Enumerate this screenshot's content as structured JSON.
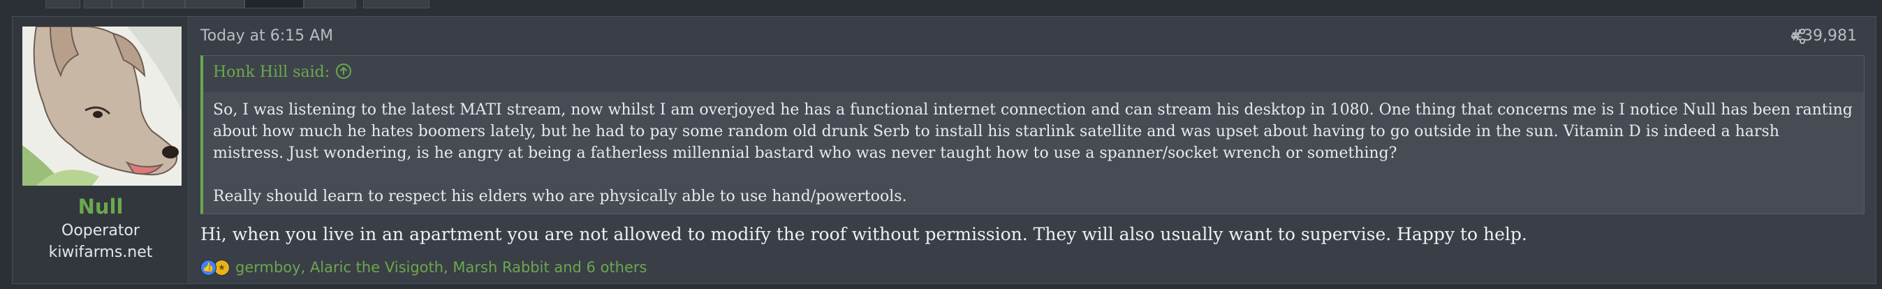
{
  "post": {
    "username": "Null",
    "user_title": "Ooperator",
    "user_extra": "kiwifarms.net",
    "date": "Today at 6:15 AM",
    "post_number": "#39,981",
    "quote": {
      "author_line": "Honk Hill said:",
      "paragraphs": [
        "So, I was listening to the latest MATI stream, now whilst I am overjoyed he has a functional internet connection and can stream his desktop in 1080. One thing that concerns me is I notice Null has been ranting about how much he hates boomers lately, but he had to pay some random old drunk Serb to install his starlink satellite and was upset about having to go outside in the sun. Vitamin D is indeed a harsh mistress. Just wondering, is he angry at being a fatherless millennial bastard who was never taught how to use a spanner/socket wrench or something?",
        "Really should learn to respect his elders who are physically able to use hand/powertools."
      ]
    },
    "message": "Hi, when you live in an apartment you are not allowed to modify the roof without permission. They will also usually want to supervise. Happy to help.",
    "reactions_text": "germboy, Alaric the Visigoth, Marsh Rabbit and 6 others",
    "reaction_icons": [
      "like-icon",
      "medal-icon"
    ]
  },
  "icons": {
    "share": "share-icon",
    "quote_jump": "arrow-up-circle-icon"
  },
  "colors": {
    "accent_green": "#6aa84f",
    "post_bg": "#3a3e46",
    "page_bg": "#2b2f36"
  }
}
